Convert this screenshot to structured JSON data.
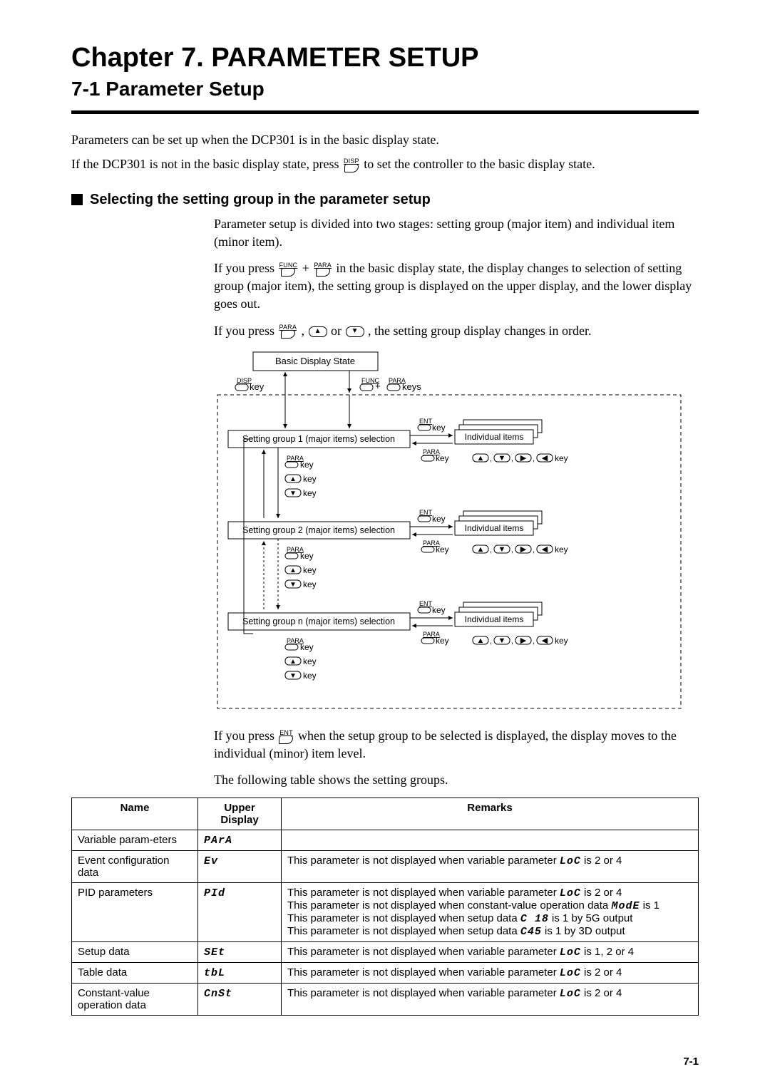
{
  "chapter_title": "Chapter 7.   PARAMETER SETUP",
  "section_title": "7-1   Parameter Setup",
  "intro1": "Parameters can be set up when the DCP301 is in the basic display state.",
  "intro2_a": "If the DCP301 is not in the basic display state, press ",
  "intro2_b": " to set the controller to the basic display state.",
  "subhead": "Selecting the setting group in the parameter setup",
  "p1": "Parameter setup is divided into two stages: setting group (major item) and individual item (minor item).",
  "p2_a": "If you press ",
  "p2_b": " + ",
  "p2_c": " in the basic display state, the display changes to selection of setting group (major item), the setting group is displayed on the upper display, and the lower display goes out.",
  "p3_a": "If you press ",
  "p3_b": ", ",
  "p3_c": " or ",
  "p3_d": ", the setting group display changes in order.",
  "p4_a": "If you press ",
  "p4_b": " when the setup group to be selected is displayed, the display moves to the individual (minor) item level.",
  "p5": "The following table shows the setting groups.",
  "keys": {
    "DISP": "DISP",
    "FUNC": "FUNC",
    "PARA": "PARA",
    "ENT": "ENT"
  },
  "diagram": {
    "basic": "Basic Display State",
    "disp_key": " key",
    "funcplus": " + ",
    "keys_suffix": " keys",
    "group1": "Setting group 1 (major items) selection",
    "group2": "Setting group 2 (major items) selection",
    "groupn": "Setting group n (major items) selection",
    "ind": "Individual items",
    "key_word": " key",
    "arrow_keys_suffix": " key",
    "vert_keys_list": [
      "PARA",
      "▲",
      "▼"
    ]
  },
  "table": {
    "headers": {
      "name": "Name",
      "upper": "Upper Display",
      "remarks": "Remarks"
    },
    "rows": [
      {
        "name": "Variable param-eters",
        "seg": "PArA",
        "remarks": []
      },
      {
        "name": "Event configuration data",
        "seg": "Ev",
        "remarks": [
          {
            "pre": "This parameter is not displayed when variable parameter ",
            "seg": "LoC",
            "post": " is 2 or 4"
          }
        ]
      },
      {
        "name": "PID parameters",
        "seg": "PId",
        "remarks": [
          {
            "pre": "This parameter is not displayed when variable parameter ",
            "seg": "LoC",
            "post": " is 2 or 4"
          },
          {
            "pre": "This parameter is not displayed when constant-value operation data ",
            "seg": "ModE",
            "post": " is 1"
          },
          {
            "pre": "This parameter is not displayed when setup data ",
            "seg": "C 18",
            "post": " is 1 by 5G output"
          },
          {
            "pre": "This parameter is not displayed when setup data ",
            "seg": "C45",
            "post": " is 1 by 3D output"
          }
        ]
      },
      {
        "name": "Setup data",
        "seg": "SEt",
        "remarks": [
          {
            "pre": "This parameter is not displayed when variable parameter ",
            "seg": "LoC",
            "post": " is 1, 2 or 4"
          }
        ]
      },
      {
        "name": "Table data",
        "seg": "tbL",
        "remarks": [
          {
            "pre": "This parameter is not displayed when variable parameter ",
            "seg": "LoC",
            "post": " is 2 or 4"
          }
        ]
      },
      {
        "name": "Constant-value operation data",
        "seg": "CnSt",
        "remarks": [
          {
            "pre": "This parameter is not displayed when variable parameter ",
            "seg": "LoC",
            "post": " is 2 or 4"
          }
        ]
      }
    ]
  },
  "pagenum": "7-1"
}
